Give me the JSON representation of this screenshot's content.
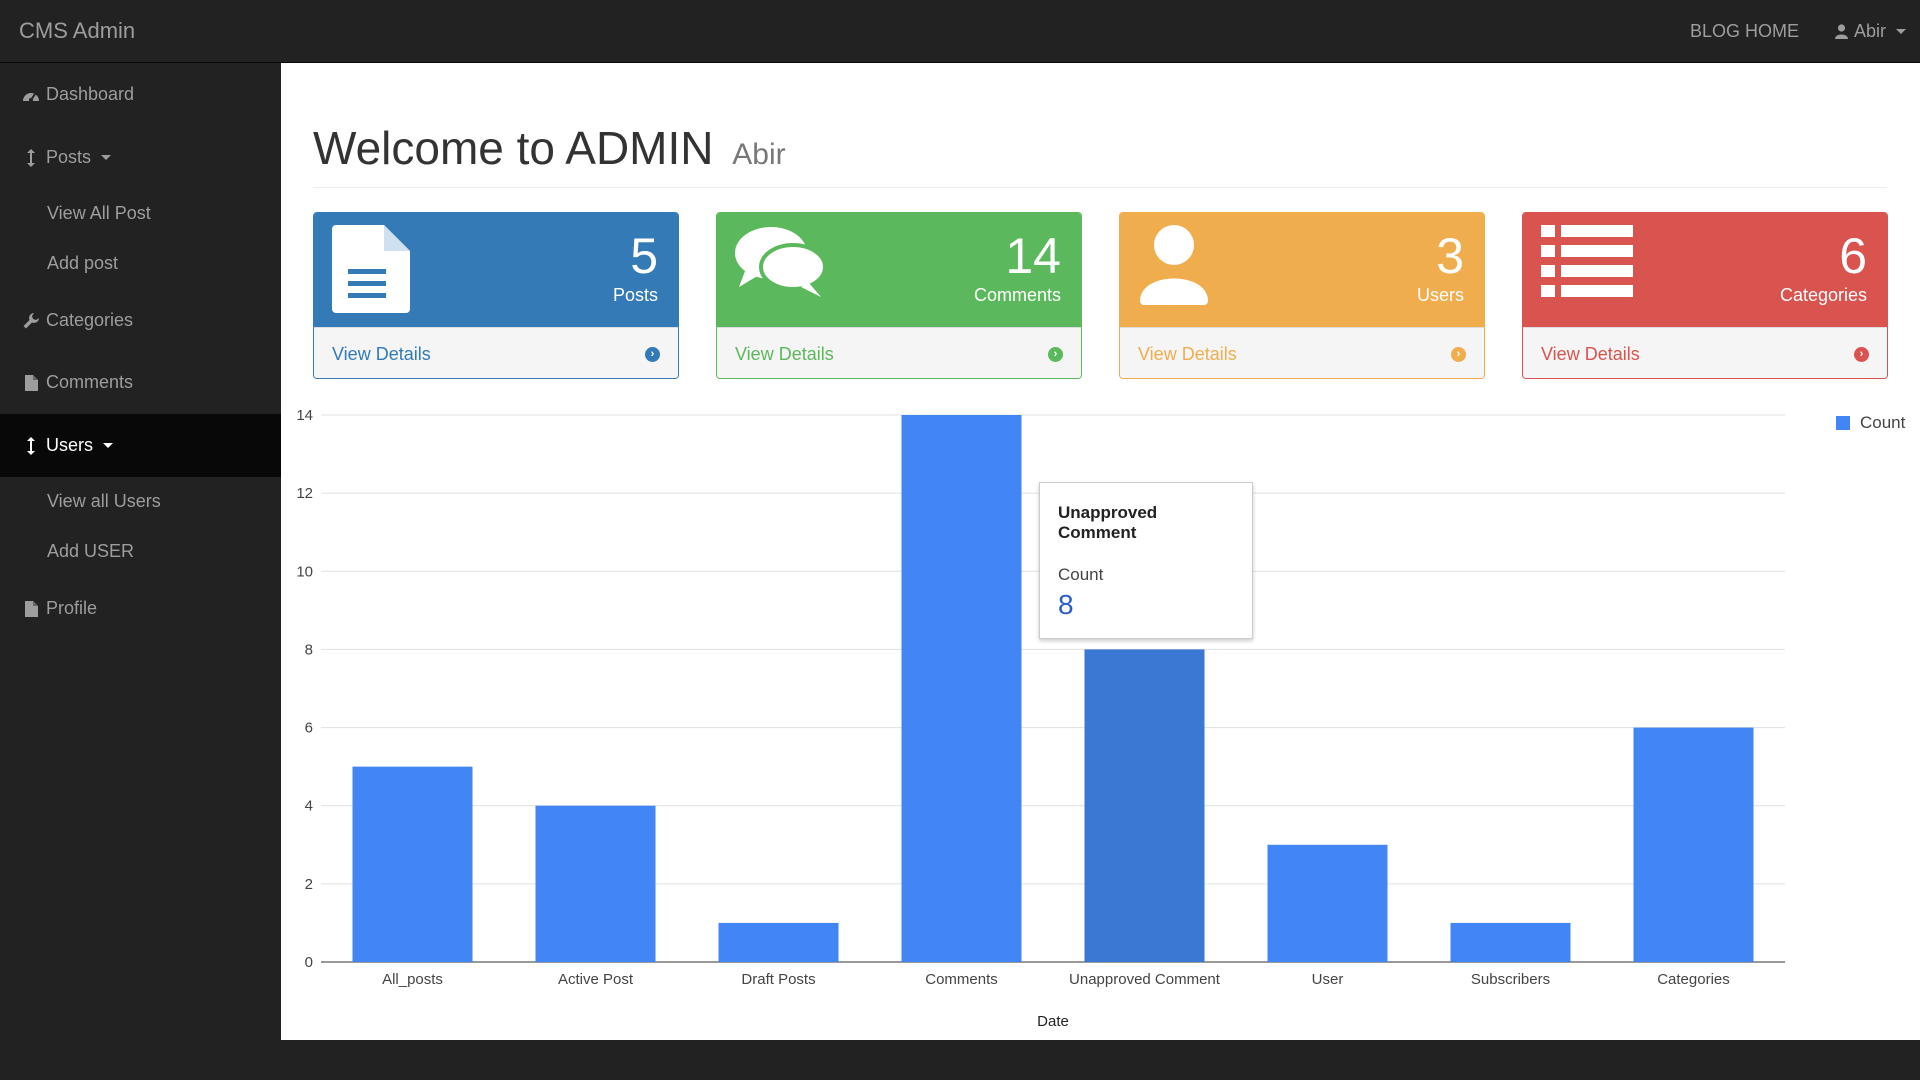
{
  "navbar": {
    "brand": "CMS Admin",
    "blog_home": "BLOG HOME",
    "user": "Abir"
  },
  "sidebar": {
    "items": [
      {
        "label": "Dashboard",
        "icon": "dashboard-icon"
      },
      {
        "label": "Posts",
        "icon": "arrows-v-icon"
      },
      {
        "label": "Categories",
        "icon": "wrench-icon"
      },
      {
        "label": "Comments",
        "icon": "file-icon"
      },
      {
        "label": "Users",
        "icon": "arrows-v-icon"
      },
      {
        "label": "Profile",
        "icon": "file-icon"
      }
    ],
    "posts_sub": [
      "View All Post",
      "Add post"
    ],
    "users_sub": [
      "View all Users",
      "Add USER"
    ]
  },
  "header": {
    "title": "Welcome to ADMIN",
    "subtitle": "Abir"
  },
  "panels": [
    {
      "count": "5",
      "label": "Posts",
      "footer": "View Details",
      "color": "#337ab7",
      "icon": "file-text-icon"
    },
    {
      "count": "14",
      "label": "Comments",
      "footer": "View Details",
      "color": "#5cb85c",
      "icon": "comments-icon"
    },
    {
      "count": "3",
      "label": "Users",
      "footer": "View Details",
      "color": "#f0ad4e",
      "icon": "user-icon"
    },
    {
      "count": "6",
      "label": "Categories",
      "footer": "View Details",
      "color": "#d9534f",
      "icon": "list-icon"
    }
  ],
  "chart_data": {
    "type": "bar",
    "categories": [
      "All_posts",
      "Active Post",
      "Draft Posts",
      "Comments",
      "Unapproved Comment",
      "User",
      "Subscribers",
      "Categories"
    ],
    "series": [
      {
        "name": "Count",
        "values": [
          5,
          4,
          1,
          14,
          8,
          3,
          1,
          6
        ]
      }
    ],
    "xlabel": "Date",
    "ylabel": "",
    "ylim": [
      0,
      14
    ],
    "yticks": [
      0,
      2,
      4,
      6,
      8,
      10,
      12,
      14
    ],
    "grid": true,
    "legend": "right",
    "bar_color": "#4285f4",
    "highlight_color": "#3a78d4",
    "highlighted_index": 4
  },
  "tooltip": {
    "title": "Unapproved Comment",
    "series": "Count",
    "value": "8"
  }
}
